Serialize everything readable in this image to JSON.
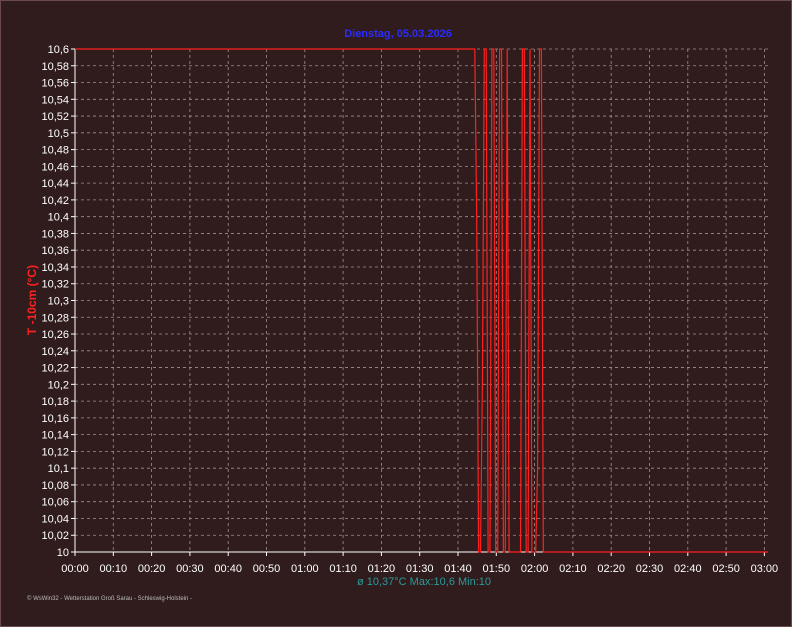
{
  "chart_data": {
    "type": "line",
    "title": "Dienstag, 05.03.2026",
    "ylabel": "T -10cm (°C)",
    "xlabel": "",
    "ylim": [
      10.0,
      10.6
    ],
    "xlim": [
      0,
      182
    ],
    "y_ticks": [
      "10,6",
      "10,58",
      "10,56",
      "10,54",
      "10,52",
      "10,5",
      "10,48",
      "10,46",
      "10,44",
      "10,42",
      "10,4",
      "10,38",
      "10,36",
      "10,34",
      "10,32",
      "10,3",
      "10,28",
      "10,26",
      "10,24",
      "10,22",
      "10,2",
      "10,18",
      "10,16",
      "10,14",
      "10,12",
      "10,1",
      "10,08",
      "10,06",
      "10,04",
      "10,02",
      "10"
    ],
    "x_ticks": [
      "00:00",
      "00:10",
      "00:20",
      "00:30",
      "00:40",
      "00:50",
      "01:00",
      "01:10",
      "01:20",
      "01:30",
      "01:40",
      "01:50",
      "02:00",
      "02:10",
      "02:20",
      "02:30",
      "02:40",
      "02:50",
      "03:00"
    ],
    "grid": true,
    "series": [
      {
        "color": "#ff2020",
        "x": [
          0,
          105,
          105.5,
          106,
          106.5,
          107,
          107.5,
          108,
          108.5,
          109,
          109.5,
          110,
          110.5,
          111,
          111.5,
          112,
          112.5,
          113,
          113.5,
          114,
          117,
          117.5,
          118,
          118.5,
          119,
          119.5,
          120,
          121,
          121.5,
          122,
          122.5,
          123,
          123.5,
          124,
          182
        ],
        "y": [
          10.6,
          10.6,
          10.4,
          10.0,
          10.0,
          10.2,
          10.6,
          10.6,
          10.0,
          10.0,
          10.6,
          10.6,
          10.0,
          10.0,
          10.6,
          10.6,
          10.0,
          10.0,
          10.6,
          10.0,
          10.0,
          10.6,
          10.6,
          10.0,
          10.0,
          10.6,
          10.0,
          10.0,
          10.1,
          10.6,
          10.6,
          10.0,
          10.0,
          10.0,
          10.0
        ]
      }
    ],
    "stats_text": "ø 10,37°C  Max:10,6  Min:10"
  },
  "footer_text": "© WsWin32 - Wetterstation Groß Sarau - Schleswig-Holstein -",
  "colors": {
    "background": "#301c1c",
    "grid": "#a09090",
    "series": "#ff2020",
    "title": "#2b2bff",
    "stats": "#2a9a9a"
  }
}
